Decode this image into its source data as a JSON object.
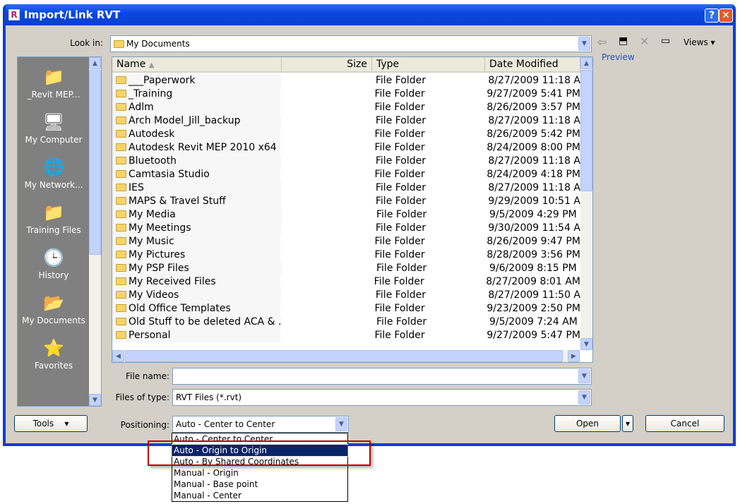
{
  "window": {
    "title": "Import/Link RVT",
    "app_icon": "R"
  },
  "toolbar": {
    "look_in_label": "Look in:",
    "look_in_value": "My Documents",
    "views_label": "Views",
    "preview_label": "Preview"
  },
  "places": [
    {
      "label": "_Revit MEP...",
      "icon": "folder"
    },
    {
      "label": "My Computer",
      "icon": "computer"
    },
    {
      "label": "My Network...",
      "icon": "globe"
    },
    {
      "label": "Training Files",
      "icon": "folder"
    },
    {
      "label": "History",
      "icon": "clock"
    },
    {
      "label": "My Documents",
      "icon": "documents"
    },
    {
      "label": "Favorites",
      "icon": "star"
    }
  ],
  "list": {
    "columns": [
      "Name",
      "Size",
      "Type",
      "Date Modified"
    ],
    "rows": [
      [
        "___Paperwork",
        "File Folder",
        "8/27/2009 11:18 A"
      ],
      [
        "_Training",
        "File Folder",
        "9/27/2009 5:41 PM"
      ],
      [
        "Adlm",
        "File Folder",
        "8/26/2009 3:57 PM"
      ],
      [
        "Arch Model_Jill_backup",
        "File Folder",
        "8/27/2009 11:18 A"
      ],
      [
        "Autodesk",
        "File Folder",
        "8/26/2009 5:42 PM"
      ],
      [
        "Autodesk Revit MEP 2010 x64",
        "File Folder",
        "8/24/2009 8:00 PM"
      ],
      [
        "Bluetooth",
        "File Folder",
        "8/27/2009 11:18 A"
      ],
      [
        "Camtasia Studio",
        "File Folder",
        "8/24/2009 4:18 PM"
      ],
      [
        "IES",
        "File Folder",
        "8/27/2009 11:18 A"
      ],
      [
        "MAPS & Travel Stuff",
        "File Folder",
        "9/29/2009 10:51 A"
      ],
      [
        "My Media",
        "File Folder",
        "9/5/2009 4:29 PM"
      ],
      [
        "My Meetings",
        "File Folder",
        "9/30/2009 11:54 A"
      ],
      [
        "My Music",
        "File Folder",
        "8/26/2009 9:47 PM"
      ],
      [
        "My Pictures",
        "File Folder",
        "8/28/2009 3:56 PM"
      ],
      [
        "My PSP Files",
        "File Folder",
        "9/6/2009 8:15 PM"
      ],
      [
        "My Received Files",
        "File Folder",
        "8/27/2009 8:01 AM"
      ],
      [
        "My Videos",
        "File Folder",
        "8/27/2009 11:50 A"
      ],
      [
        "Old Office Templates",
        "File Folder",
        "9/23/2009 2:50 PM"
      ],
      [
        "Old Stuff to be deleted ACA & ...",
        "File Folder",
        "9/5/2009 7:24 AM"
      ],
      [
        "Personal",
        "File Folder",
        "9/27/2009 5:47 PM"
      ]
    ]
  },
  "form": {
    "file_name_label": "File name:",
    "file_name_value": "",
    "file_type_label": "Files of type:",
    "file_type_value": "RVT Files  (*.rvt)",
    "positioning_label": "Positioning:",
    "positioning_value": "Auto - Center to Center"
  },
  "buttons": {
    "tools": "Tools",
    "open": "Open",
    "cancel": "Cancel"
  },
  "positioning_options": [
    "Auto - Center to Center",
    "Auto - Origin to Origin",
    "Auto - By Shared Coordinates",
    "Manual - Origin",
    "Manual - Base point",
    "Manual - Center"
  ]
}
